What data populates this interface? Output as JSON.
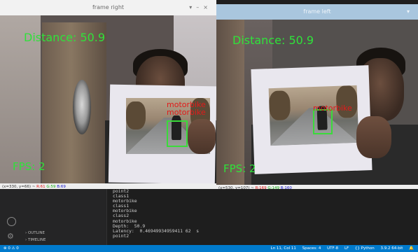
{
  "window_right": {
    "title": "frame right",
    "distance_text": "Distance: 50.9",
    "fps_text": "FPS: 2",
    "labels": [
      "motorbike",
      "motorbike"
    ],
    "status": {
      "coords": "(x=330, y=66) ~",
      "r": "R:61",
      "g": "G:59",
      "b": "B:69"
    }
  },
  "window_left": {
    "title": "frame left",
    "distance_text": "Distance: 50.9",
    "fps_text": "FPS: 2",
    "label": "motorbike",
    "status": {
      "coords": "(x=530, y=107) ~",
      "r": "R:169",
      "g": "G:149",
      "b": "B:160"
    }
  },
  "terminal": {
    "lines": [
      "point2",
      "class1",
      "motorbike",
      "class1",
      "motorbike",
      "class2",
      "motorbike",
      "Depth:  50.9",
      "Latency:  0.46949934959411 62  s",
      "point2"
    ]
  },
  "sidebar": {
    "outline": "OUTLINE",
    "timeline": "TIMELINE"
  },
  "statusbar": {
    "left": "⊗ 0 ⚠ 0",
    "items": [
      "Ln 11, Col 11",
      "Spaces: 4",
      "UTF-8",
      "LF",
      "{} Python",
      "3.9.2 64-bit"
    ]
  },
  "colors": {
    "detection_box": "#3adb3a",
    "detection_label": "#e21a1a",
    "overlay_text": "#2fe23a",
    "statusbar": "#007acc"
  }
}
